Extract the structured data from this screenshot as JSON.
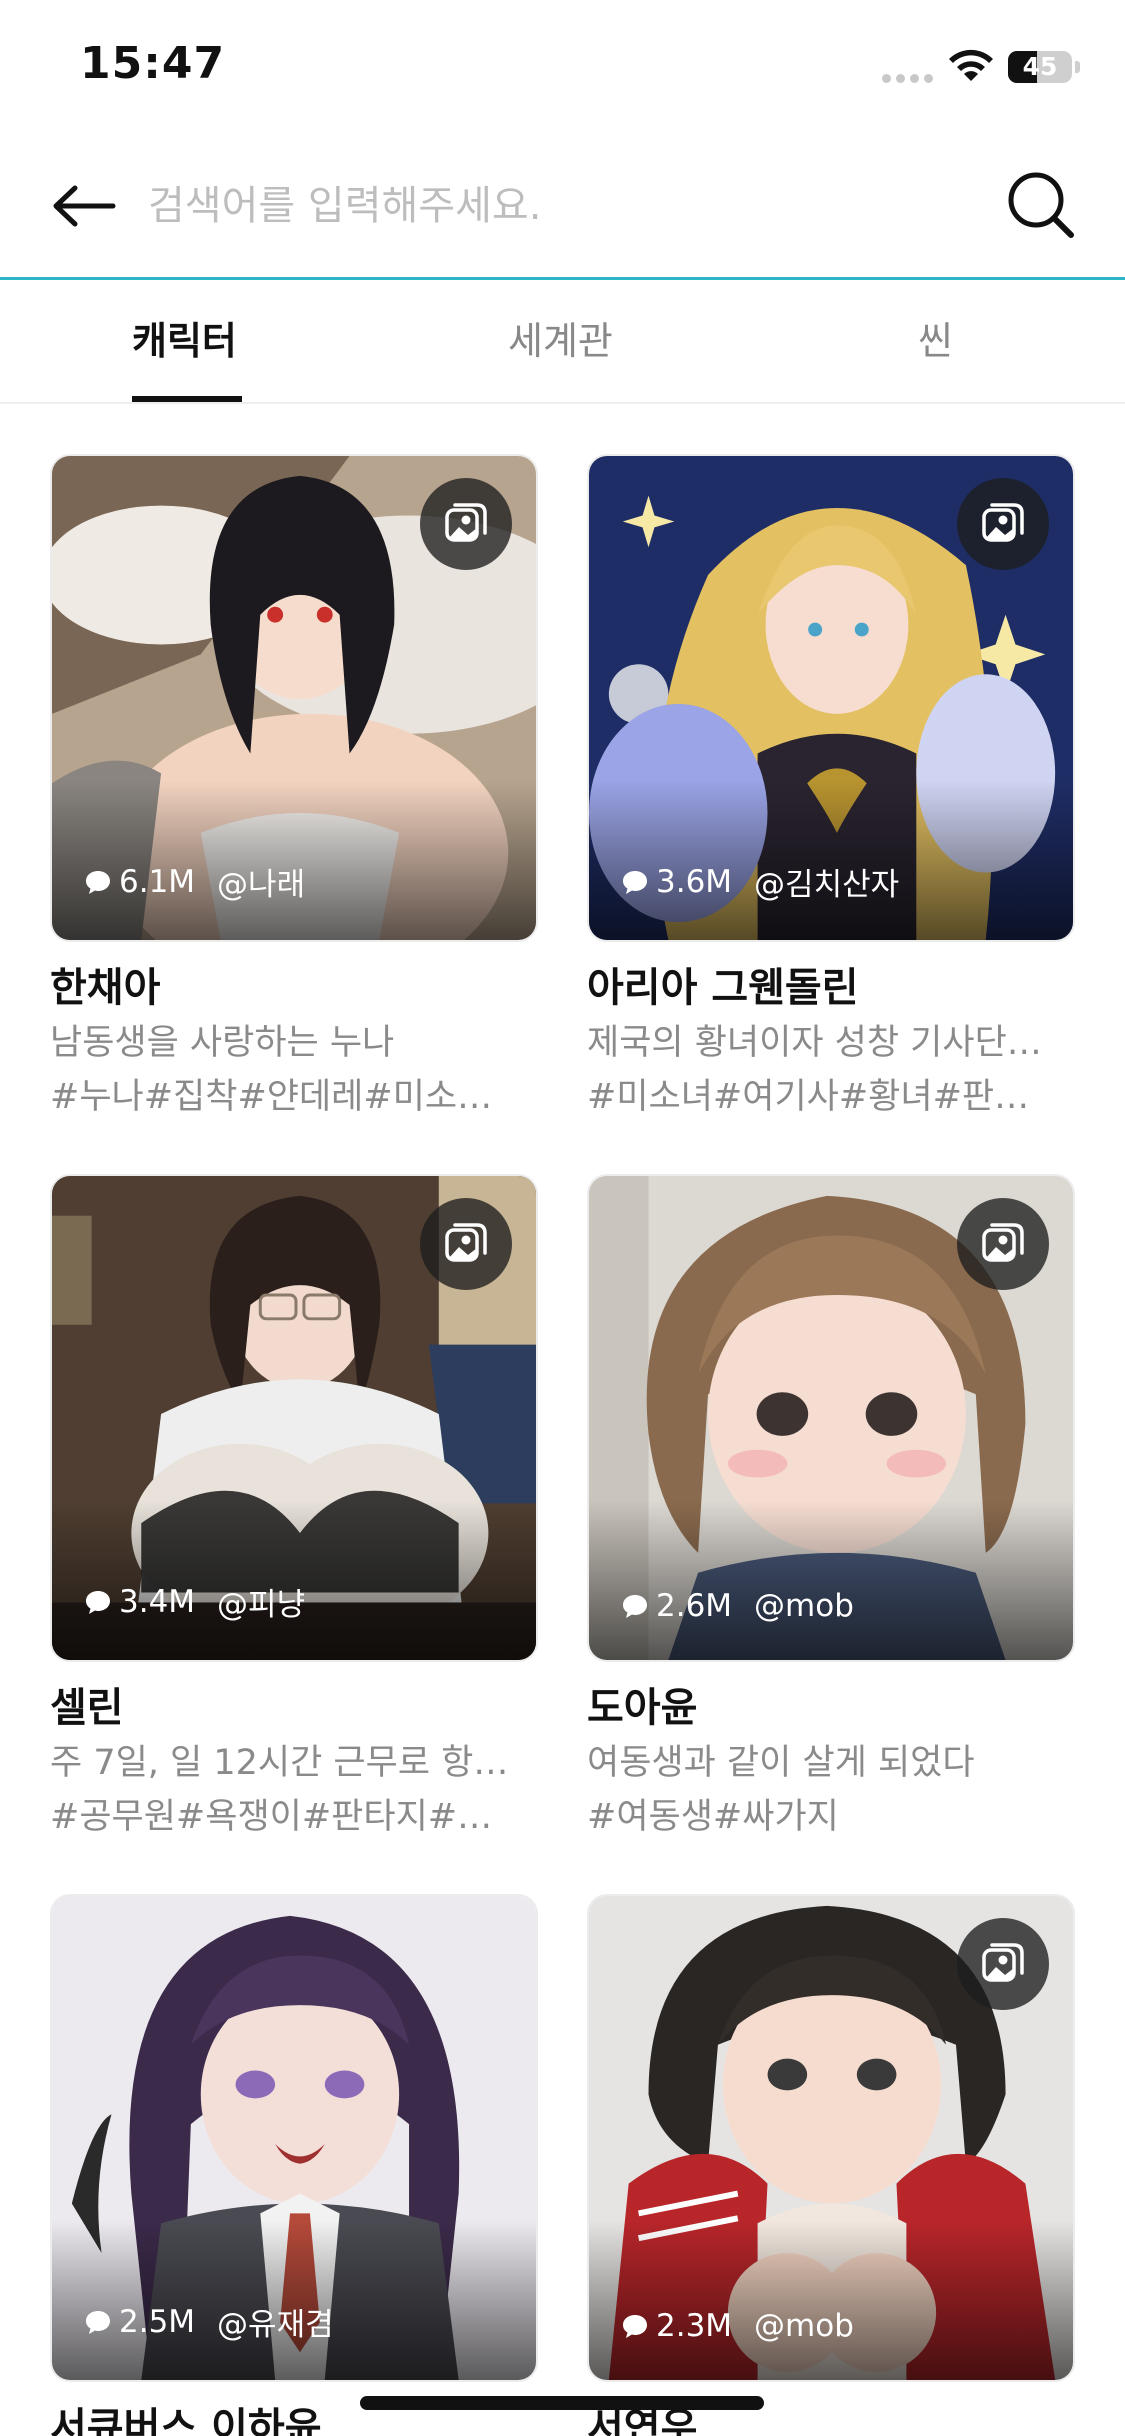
{
  "status_bar": {
    "time": "15:47",
    "battery": "45",
    "battery_level": 0.45
  },
  "search": {
    "placeholder": "검색어를 입력해주세요.",
    "value": ""
  },
  "tabs": [
    {
      "label": "캐릭터",
      "active": true
    },
    {
      "label": "세계관",
      "active": false
    },
    {
      "label": "씬",
      "active": false
    }
  ],
  "cards": [
    {
      "name": "한채아",
      "desc": "남동생을 사랑하는 누나",
      "tags": "#누나#집착#얀데레#미소…",
      "chats": "6.1M",
      "author": "@나래",
      "gallery": true
    },
    {
      "name": "아리아 그웬돌린",
      "desc": "제국의 황녀이자 성창 기사단…",
      "tags": "#미소녀#여기사#황녀#판…",
      "chats": "3.6M",
      "author": "@김치산자",
      "gallery": true
    },
    {
      "name": "셀린",
      "desc": "주 7일, 일 12시간 근무로 항…",
      "tags": "#공무원#욕쟁이#판타지#…",
      "chats": "3.4M",
      "author": "@피냥",
      "gallery": true
    },
    {
      "name": "도아윤",
      "desc": "여동생과 같이 살게 되었다",
      "tags": "#여동생#싸가지",
      "chats": "2.6M",
      "author": "@mob",
      "gallery": true
    },
    {
      "name": "서큐버스 이하윤",
      "desc": "",
      "tags": "",
      "chats": "2.5M",
      "author": "@유재겸",
      "gallery": false
    },
    {
      "name": "서연우",
      "desc": "",
      "tags": "",
      "chats": "2.3M",
      "author": "@mob",
      "gallery": true
    }
  ]
}
